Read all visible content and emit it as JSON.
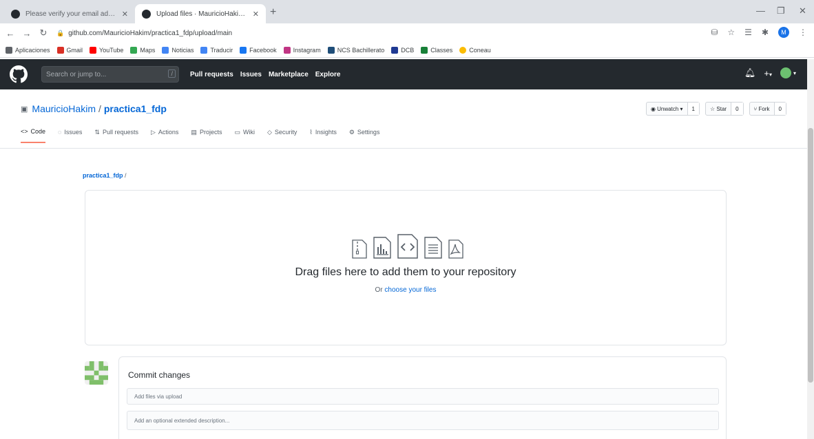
{
  "browser": {
    "tabs": [
      {
        "title": "Please verify your email address"
      },
      {
        "title": "Upload files · MauricioHakim/practica1_fdp"
      }
    ],
    "new_tab": "+",
    "url": "github.com/MauricioHakim/practica1_fdp/upload/main",
    "profile_initial": "M",
    "bookmarks": [
      "Aplicaciones",
      "Gmail",
      "YouTube",
      "Maps",
      "Noticias",
      "Traducir",
      "Facebook",
      "Instagram",
      "NCS Bachillerato",
      "DCB",
      "Classes",
      "Coneau"
    ]
  },
  "github": {
    "search_placeholder": "Search or jump to...",
    "search_shortcut": "/",
    "nav": [
      "Pull requests",
      "Issues",
      "Marketplace",
      "Explore"
    ],
    "plus_label": "+",
    "repo": {
      "owner": "MauricioHakim",
      "separator": "/",
      "name": "practica1_fdp"
    },
    "actions": [
      {
        "label": "◉ Unwatch ▾",
        "count": "1"
      },
      {
        "label": "☆ Star",
        "count": "0"
      },
      {
        "label": "⑂ Fork",
        "count": "0"
      }
    ],
    "tabs": [
      "Code",
      "Issues",
      "Pull requests",
      "Actions",
      "Projects",
      "Wiki",
      "Security",
      "Insights",
      "Settings"
    ]
  },
  "upload": {
    "breadcrumb_repo": "practica1_fdp",
    "breadcrumb_sep": "/",
    "drop_title": "Drag files here to add them to your repository",
    "drop_sub_prefix": "Or ",
    "drop_sub_link": "choose your files"
  },
  "commit": {
    "title": "Commit changes",
    "summary_placeholder": "Add files via upload",
    "description_placeholder": "Add an optional extended description..."
  }
}
